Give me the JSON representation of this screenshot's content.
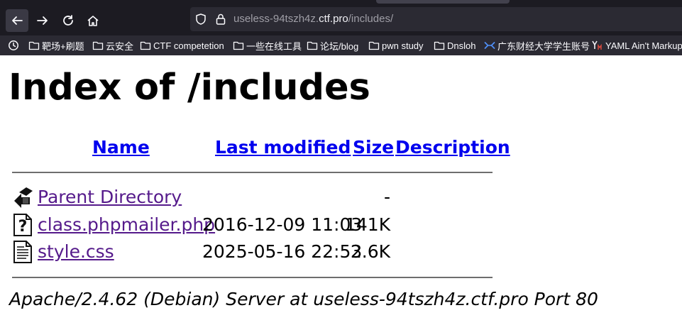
{
  "browser": {
    "url": {
      "prefix": "useless-94tszh4z.",
      "host": "ctf.pro",
      "path": "/includes/"
    },
    "bookmarks": [
      {
        "label": "靶场+刷题",
        "icon": "folder-icon"
      },
      {
        "label": "云安全",
        "icon": "folder-icon"
      },
      {
        "label": "CTF competetion",
        "icon": "folder-icon"
      },
      {
        "label": "一些在线工具",
        "icon": "folder-icon"
      },
      {
        "label": "论坛/blog",
        "icon": "folder-icon"
      },
      {
        "label": "pwn study",
        "icon": "folder-icon"
      },
      {
        "label": "Dnsloh",
        "icon": "folder-icon"
      },
      {
        "label": "广东财经大学学生账号",
        "icon": "site-logo-icon"
      },
      {
        "label": "YAML Ain't Markup",
        "icon": "yaml-logo-icon"
      }
    ]
  },
  "page": {
    "title": "Index of /includes",
    "columns": {
      "name": "Name",
      "last_modified": "Last modified",
      "size": "Size",
      "description": "Description"
    },
    "rows": [
      {
        "name": "Parent Directory",
        "modified": "",
        "size": "-",
        "icon": "back-arrow-icon"
      },
      {
        "name": "class.phpmailer.php",
        "modified": "2016-12-09 11:03",
        "size": "141K",
        "icon": "unknown-file-icon"
      },
      {
        "name": "style.css",
        "modified": "2025-05-16 22:53",
        "size": "2.6K",
        "icon": "text-file-icon"
      }
    ],
    "address": "Apache/2.4.62 (Debian) Server at useless-94tszh4z.ctf.pro Port 80"
  }
}
